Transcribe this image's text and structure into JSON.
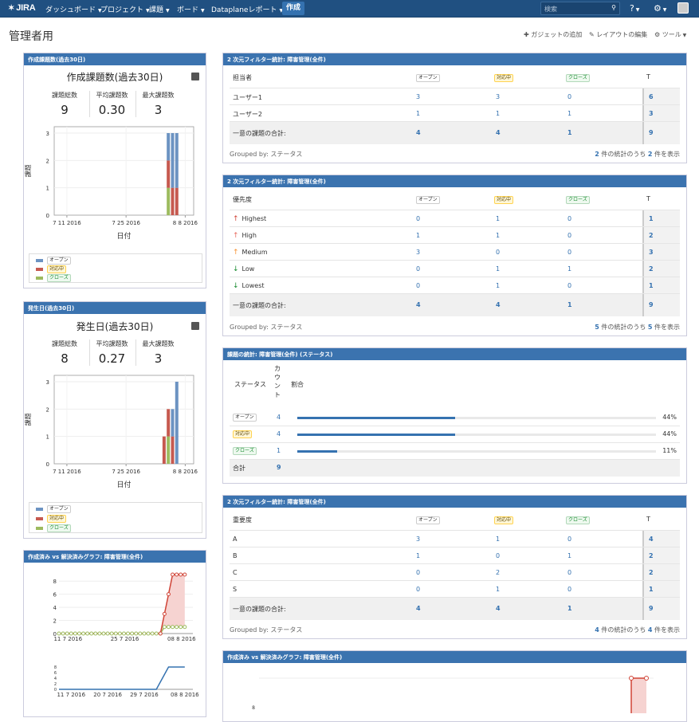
{
  "nav": {
    "logo": "JIRA",
    "items": [
      "ダッシュボード",
      "プロジェクト",
      "課題",
      "ボード",
      "Dataplaneレポート"
    ],
    "create": "作成",
    "search_placeholder": "検索"
  },
  "page": {
    "title": "管理者用",
    "add_gadget": "ガジェットの追加",
    "edit_layout": "レイアウトの編集",
    "tools": "ツール"
  },
  "status_labels": {
    "open": "オープン",
    "progress": "対応中",
    "closed": "クローズ"
  },
  "colors": {
    "open": "#6c93c2",
    "progress": "#c6594f",
    "closed": "#9dbb5e",
    "accent": "#3572b0",
    "header": "#205081"
  },
  "created": {
    "header": "作成課題数(過去30日)",
    "title": "作成課題数(過去30日)",
    "stats": [
      {
        "label": "課題総数",
        "value": "9"
      },
      {
        "label": "平均課題数",
        "value": "0.30"
      },
      {
        "label": "最大課題数",
        "value": "3"
      }
    ],
    "ylabel": "課題",
    "xlabel": "日付",
    "xticks": [
      "7 11 2016",
      "7 25 2016",
      "8 8 2016"
    ],
    "yticks": [
      "0",
      "1",
      "2",
      "3"
    ]
  },
  "resolved": {
    "header": "発生日(過去30日)",
    "title": "発生日(過去30日)",
    "stats": [
      {
        "label": "課題総数",
        "value": "8"
      },
      {
        "label": "平均課題数",
        "value": "0.27"
      },
      {
        "label": "最大課題数",
        "value": "3"
      }
    ],
    "ylabel": "課題",
    "xlabel": "日付",
    "xticks": [
      "7 11 2016",
      "7 25 2016",
      "8 8 2016"
    ],
    "yticks": [
      "0",
      "1",
      "2",
      "3"
    ]
  },
  "cvr": {
    "header": "作成済み vs 解決済みグラフ: 障害管理(全件)",
    "yticks": [
      "0",
      "2",
      "4",
      "6",
      "8"
    ],
    "xticks": [
      "11 7 2016",
      "25 7 2016",
      "08 8 2016"
    ],
    "xticks2": [
      "11 7 2016",
      "20 7 2016",
      "29 7 2016",
      "08 8 2016"
    ],
    "yticks2": [
      "0",
      "2",
      "4",
      "6",
      "8"
    ]
  },
  "cvr2": {
    "header": "作成済み vs 解決済みグラフ: 障害管理(全件)",
    "ytick": "8"
  },
  "t1": {
    "header": "2 次元フィルター統計: 障害管理(全件)",
    "col0": "担当者",
    "tcol": "T",
    "rows": [
      {
        "name": "ユーザー1",
        "v": [
          "3",
          "3",
          "0"
        ],
        "t": "6"
      },
      {
        "name": "ユーザー2",
        "v": [
          "1",
          "1",
          "1"
        ],
        "t": "3"
      }
    ],
    "total": {
      "name": "一意の課題の合計:",
      "v": [
        "4",
        "4",
        "1"
      ],
      "t": "9"
    },
    "groupby": "Grouped by: ステータス",
    "count_pre": "2",
    "count_mid": " 件の統計のうち ",
    "count_n": "2",
    "count_post": " 件を表示"
  },
  "t2": {
    "header": "2 次元フィルター統計: 障害管理(全件)",
    "col0": "優先度",
    "tcol": "T",
    "rows": [
      {
        "name": "Highest",
        "icon": "arrow-up-icon",
        "color": "#d04437",
        "v": [
          "0",
          "1",
          "0"
        ],
        "t": "1"
      },
      {
        "name": "High",
        "icon": "arrow-up-icon",
        "color": "#e86a5f",
        "v": [
          "1",
          "1",
          "0"
        ],
        "t": "2"
      },
      {
        "name": "Medium",
        "icon": "arrow-up-icon",
        "color": "#f79232",
        "v": [
          "3",
          "0",
          "0"
        ],
        "t": "3"
      },
      {
        "name": "Low",
        "icon": "arrow-down-icon",
        "color": "#14892c",
        "v": [
          "0",
          "1",
          "1"
        ],
        "t": "2"
      },
      {
        "name": "Lowest",
        "icon": "arrow-down-icon",
        "color": "#14892c",
        "v": [
          "0",
          "1",
          "0"
        ],
        "t": "1"
      }
    ],
    "total": {
      "name": "一意の課題の合計:",
      "v": [
        "4",
        "4",
        "1"
      ],
      "t": "9"
    },
    "groupby": "Grouped by: ステータス",
    "count_pre": "5",
    "count_mid": " 件の統計のうち ",
    "count_n": "5",
    "count_post": " 件を表示"
  },
  "t3": {
    "header": "課題の統計: 障害管理(全件) (ステータス)",
    "col_status": "ステータス",
    "col_count": "カウント",
    "col_ratio": "割合",
    "rows": [
      {
        "status": "オープン",
        "cls": "open",
        "count": "4",
        "pct": "44%",
        "frac": 0.44
      },
      {
        "status": "対応中",
        "cls": "prog",
        "count": "4",
        "pct": "44%",
        "frac": 0.44
      },
      {
        "status": "クローズ",
        "cls": "done",
        "count": "1",
        "pct": "11%",
        "frac": 0.11
      }
    ],
    "total_label": "合計",
    "total": "9"
  },
  "t4": {
    "header": "2 次元フィルター統計: 障害管理(全件)",
    "col0": "重要度",
    "tcol": "T",
    "rows": [
      {
        "name": "A",
        "v": [
          "3",
          "1",
          "0"
        ],
        "t": "4"
      },
      {
        "name": "B",
        "v": [
          "1",
          "0",
          "1"
        ],
        "t": "2"
      },
      {
        "name": "C",
        "v": [
          "0",
          "2",
          "0"
        ],
        "t": "2"
      },
      {
        "name": "S",
        "v": [
          "0",
          "1",
          "0"
        ],
        "t": "1"
      }
    ],
    "total": {
      "name": "一意の課題の合計:",
      "v": [
        "4",
        "4",
        "1"
      ],
      "t": "9"
    },
    "groupby": "Grouped by: ステータス",
    "count_pre": "4",
    "count_mid": " 件の統計のうち ",
    "count_n": "4",
    "count_post": " 件を表示"
  },
  "chart_data": [
    {
      "type": "bar",
      "title": "作成課題数(過去30日)",
      "xlabel": "日付",
      "ylabel": "課題",
      "ylim": [
        0,
        3
      ],
      "categories": [
        "2016-08-04",
        "2016-08-05",
        "2016-08-06"
      ],
      "series": [
        {
          "name": "クローズ",
          "values": [
            1,
            0,
            0
          ]
        },
        {
          "name": "対応中",
          "values": [
            1,
            1,
            1
          ]
        },
        {
          "name": "オープン",
          "values": [
            1,
            2,
            2
          ]
        }
      ],
      "stacked": true,
      "legend": "bottom"
    },
    {
      "type": "bar",
      "title": "発生日(過去30日)",
      "xlabel": "日付",
      "ylabel": "課題",
      "ylim": [
        0,
        3
      ],
      "categories": [
        "2016-08-03",
        "2016-08-04",
        "2016-08-05",
        "2016-08-06"
      ],
      "series": [
        {
          "name": "クローズ",
          "values": [
            0,
            1,
            0,
            0
          ]
        },
        {
          "name": "対応中",
          "values": [
            1,
            1,
            1,
            0
          ]
        },
        {
          "name": "オープン",
          "values": [
            0,
            0,
            1,
            3
          ]
        }
      ],
      "stacked": true,
      "legend": "bottom"
    },
    {
      "type": "line",
      "x": [
        "2016-07-08",
        "2016-08-02",
        "2016-08-03",
        "2016-08-04",
        "2016-08-05",
        "2016-08-06",
        "2016-08-07",
        "2016-08-08"
      ],
      "series": [
        {
          "values": [
            0,
            0,
            3,
            6,
            9,
            9,
            9,
            9
          ]
        },
        {
          "values": [
            0,
            0,
            1,
            1,
            1,
            1,
            1,
            1
          ]
        }
      ],
      "ylim": [
        0,
        9
      ]
    },
    {
      "type": "line",
      "x": [
        "2016-07-08",
        "2016-08-01",
        "2016-08-04",
        "2016-08-08"
      ],
      "series": [
        {
          "values": [
            0,
            0,
            8,
            8
          ]
        }
      ],
      "ylim": [
        0,
        8
      ]
    }
  ]
}
